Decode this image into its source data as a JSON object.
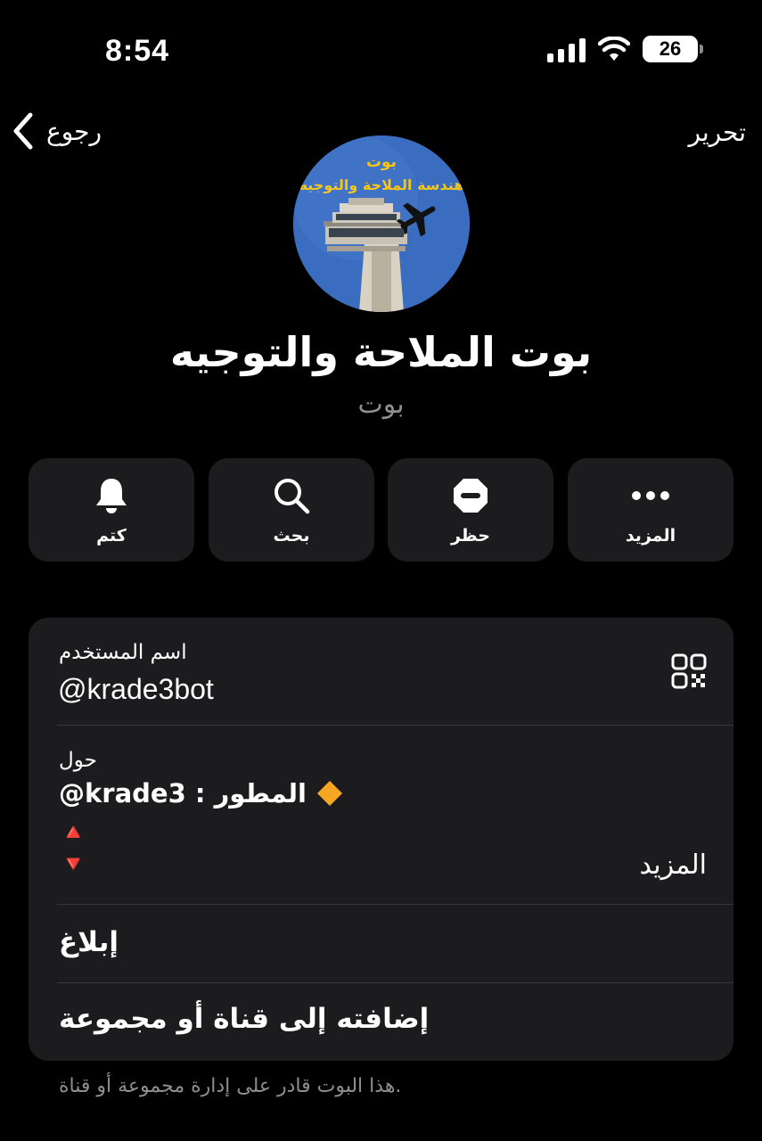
{
  "status_bar": {
    "time": "8:54",
    "battery_level": "26",
    "signal_icon": "cellular-signal-icon",
    "wifi_icon": "wifi-icon"
  },
  "nav": {
    "back_label": "رجوع",
    "edit_label": "تحرير"
  },
  "avatar": {
    "line1": "بوت",
    "line2": "هندسة الملاحة والتوجيه"
  },
  "profile": {
    "name": "بوت الملاحة والتوجيه",
    "subtitle": "بوت"
  },
  "actions": [
    {
      "label": "كتم",
      "icon": "bell-icon"
    },
    {
      "label": "بحث",
      "icon": "search-icon"
    },
    {
      "label": "حظر",
      "icon": "block-icon"
    },
    {
      "label": "المزيد",
      "icon": "ellipsis-icon"
    }
  ],
  "info": {
    "username_label": "اسم المستخدم",
    "username_value": "@krade3bot",
    "about_label": "حول",
    "about_line1": "@krade3 : المطور",
    "about_line2": "🔺",
    "about_line3": "🔻",
    "more_label": "المزيد",
    "report_label": "إبلاغ",
    "add_to_group_label": "إضافته إلى قناة أو مجموعة"
  },
  "footer_note": "هذا البوت قادر على إدارة مجموعة أو قناة.",
  "colors": {
    "background": "#000000",
    "card": "#1c1c1e",
    "secondary_text": "#8e8e93",
    "divider": "#38383a"
  }
}
